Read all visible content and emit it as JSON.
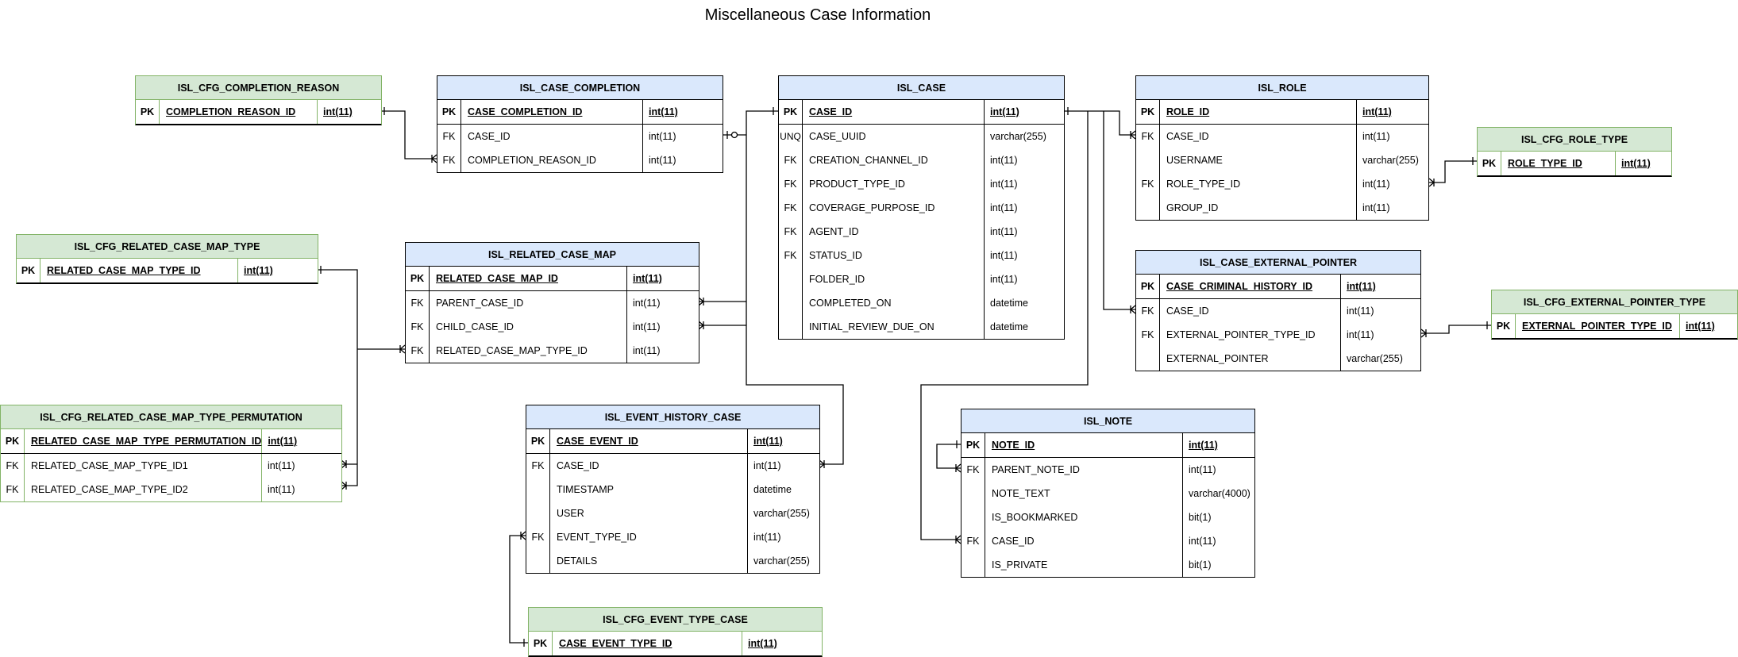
{
  "title": "Miscellaneous Case Information",
  "colors": {
    "entity_header": "#dae8fc",
    "config_header": "#d5e8d4",
    "config_border": "#82b366",
    "line": "#000000"
  },
  "tables": {
    "cfg_completion_reason": {
      "name": "ISL_CFG_COMPLETION_REASON",
      "rows": [
        {
          "key": "PK",
          "column": "COMPLETION_REASON_ID",
          "type": "int(11)"
        }
      ]
    },
    "case_completion": {
      "name": "ISL_CASE_COMPLETION",
      "rows": [
        {
          "key": "PK",
          "column": "CASE_COMPLETION_ID",
          "type": "int(11)"
        },
        {
          "key": "FK",
          "column": "CASE_ID",
          "type": "int(11)"
        },
        {
          "key": "FK",
          "column": "COMPLETION_REASON_ID",
          "type": "int(11)"
        }
      ]
    },
    "case": {
      "name": "ISL_CASE",
      "rows": [
        {
          "key": "PK",
          "column": "CASE_ID",
          "type": "int(11)"
        },
        {
          "key": "UNQ",
          "column": "CASE_UUID",
          "type": "varchar(255)"
        },
        {
          "key": "FK",
          "column": "CREATION_CHANNEL_ID",
          "type": "int(11)"
        },
        {
          "key": "FK",
          "column": "PRODUCT_TYPE_ID",
          "type": "int(11)"
        },
        {
          "key": "FK",
          "column": "COVERAGE_PURPOSE_ID",
          "type": "int(11)"
        },
        {
          "key": "FK",
          "column": "AGENT_ID",
          "type": "int(11)"
        },
        {
          "key": "FK",
          "column": "STATUS_ID",
          "type": "int(11)"
        },
        {
          "key": "",
          "column": "FOLDER_ID",
          "type": "int(11)"
        },
        {
          "key": "",
          "column": "COMPLETED_ON",
          "type": "datetime"
        },
        {
          "key": "",
          "column": "INITIAL_REVIEW_DUE_ON",
          "type": "datetime"
        }
      ]
    },
    "role": {
      "name": "ISL_ROLE",
      "rows": [
        {
          "key": "PK",
          "column": "ROLE_ID",
          "type": "int(11)"
        },
        {
          "key": "FK",
          "column": "CASE_ID",
          "type": "int(11)"
        },
        {
          "key": "",
          "column": "USERNAME",
          "type": "varchar(255)"
        },
        {
          "key": "FK",
          "column": "ROLE_TYPE_ID",
          "type": "int(11)"
        },
        {
          "key": "",
          "column": "GROUP_ID",
          "type": "int(11)"
        }
      ]
    },
    "cfg_role_type": {
      "name": "ISL_CFG_ROLE_TYPE",
      "rows": [
        {
          "key": "PK",
          "column": "ROLE_TYPE_ID",
          "type": "int(11)"
        }
      ]
    },
    "case_external_pointer": {
      "name": "ISL_CASE_EXTERNAL_POINTER",
      "rows": [
        {
          "key": "PK",
          "column": "CASE_CRIMINAL_HISTORY_ID",
          "type": "int(11)"
        },
        {
          "key": "FK",
          "column": "CASE_ID",
          "type": "int(11)"
        },
        {
          "key": "FK",
          "column": "EXTERNAL_POINTER_TYPE_ID",
          "type": "int(11)"
        },
        {
          "key": "",
          "column": "EXTERNAL_POINTER",
          "type": "varchar(255)"
        }
      ]
    },
    "cfg_external_pointer_type": {
      "name": "ISL_CFG_EXTERNAL_POINTER_TYPE",
      "rows": [
        {
          "key": "PK",
          "column": "EXTERNAL_POINTER_TYPE_ID",
          "type": "int(11)"
        }
      ]
    },
    "cfg_related_case_map_type": {
      "name": "ISL_CFG_RELATED_CASE_MAP_TYPE",
      "rows": [
        {
          "key": "PK",
          "column": "RELATED_CASE_MAP_TYPE_ID",
          "type": "int(11)"
        }
      ]
    },
    "related_case_map": {
      "name": "ISL_RELATED_CASE_MAP",
      "rows": [
        {
          "key": "PK",
          "column": "RELATED_CASE_MAP_ID",
          "type": "int(11)"
        },
        {
          "key": "FK",
          "column": "PARENT_CASE_ID",
          "type": "int(11)"
        },
        {
          "key": "FK",
          "column": "CHILD_CASE_ID",
          "type": "int(11)"
        },
        {
          "key": "FK",
          "column": "RELATED_CASE_MAP_TYPE_ID",
          "type": "int(11)"
        }
      ]
    },
    "cfg_related_case_map_type_permutation": {
      "name": "ISL_CFG_RELATED_CASE_MAP_TYPE_PERMUTATION",
      "rows": [
        {
          "key": "PK",
          "column": "RELATED_CASE_MAP_TYPE_PERMUTATION_ID",
          "type": "int(11)"
        },
        {
          "key": "FK",
          "column": "RELATED_CASE_MAP_TYPE_ID1",
          "type": "int(11)"
        },
        {
          "key": "FK",
          "column": "RELATED_CASE_MAP_TYPE_ID2",
          "type": "int(11)"
        }
      ]
    },
    "event_history_case": {
      "name": "ISL_EVENT_HISTORY_CASE",
      "rows": [
        {
          "key": "PK",
          "column": "CASE_EVENT_ID",
          "type": "int(11)"
        },
        {
          "key": "FK",
          "column": "CASE_ID",
          "type": "int(11)"
        },
        {
          "key": "",
          "column": "TIMESTAMP",
          "type": "datetime"
        },
        {
          "key": "",
          "column": "USER",
          "type": "varchar(255)"
        },
        {
          "key": "FK",
          "column": "EVENT_TYPE_ID",
          "type": "int(11)"
        },
        {
          "key": "",
          "column": "DETAILS",
          "type": "varchar(255)"
        }
      ]
    },
    "cfg_event_type_case": {
      "name": "ISL_CFG_EVENT_TYPE_CASE",
      "rows": [
        {
          "key": "PK",
          "column": "CASE_EVENT_TYPE_ID",
          "type": "int(11)"
        }
      ]
    },
    "note": {
      "name": "ISL_NOTE",
      "rows": [
        {
          "key": "PK",
          "column": "NOTE_ID",
          "type": "int(11)"
        },
        {
          "key": "FK",
          "column": "PARENT_NOTE_ID",
          "type": "int(11)"
        },
        {
          "key": "",
          "column": "NOTE_TEXT",
          "type": "varchar(4000)"
        },
        {
          "key": "",
          "column": "IS_BOOKMARKED",
          "type": "bit(1)"
        },
        {
          "key": "FK",
          "column": "CASE_ID",
          "type": "int(11)"
        },
        {
          "key": "",
          "column": "IS_PRIVATE",
          "type": "bit(1)"
        }
      ]
    }
  },
  "relationships": [
    {
      "from": "ISL_CFG_COMPLETION_REASON.COMPLETION_REASON_ID",
      "to": "ISL_CASE_COMPLETION.COMPLETION_REASON_ID",
      "cardinality": "one-to-many"
    },
    {
      "from": "ISL_CASE.CASE_ID",
      "to": "ISL_CASE_COMPLETION.CASE_ID",
      "cardinality": "one-to-zero-or-one"
    },
    {
      "from": "ISL_CASE.CASE_ID",
      "to": "ISL_RELATED_CASE_MAP.PARENT_CASE_ID",
      "cardinality": "one-to-many"
    },
    {
      "from": "ISL_CASE.CASE_ID",
      "to": "ISL_RELATED_CASE_MAP.CHILD_CASE_ID",
      "cardinality": "one-to-many"
    },
    {
      "from": "ISL_CASE.CASE_ID",
      "to": "ISL_EVENT_HISTORY_CASE.CASE_ID",
      "cardinality": "one-to-many"
    },
    {
      "from": "ISL_CASE.CASE_ID",
      "to": "ISL_ROLE.CASE_ID",
      "cardinality": "one-to-many"
    },
    {
      "from": "ISL_CASE.CASE_ID",
      "to": "ISL_CASE_EXTERNAL_POINTER.CASE_ID",
      "cardinality": "one-to-many"
    },
    {
      "from": "ISL_CASE.CASE_ID",
      "to": "ISL_NOTE.CASE_ID",
      "cardinality": "one-to-many"
    },
    {
      "from": "ISL_CFG_ROLE_TYPE.ROLE_TYPE_ID",
      "to": "ISL_ROLE.ROLE_TYPE_ID",
      "cardinality": "one-to-many"
    },
    {
      "from": "ISL_CFG_EXTERNAL_POINTER_TYPE.EXTERNAL_POINTER_TYPE_ID",
      "to": "ISL_CASE_EXTERNAL_POINTER.EXTERNAL_POINTER_TYPE_ID",
      "cardinality": "one-to-many"
    },
    {
      "from": "ISL_CFG_RELATED_CASE_MAP_TYPE.RELATED_CASE_MAP_TYPE_ID",
      "to": "ISL_RELATED_CASE_MAP.RELATED_CASE_MAP_TYPE_ID",
      "cardinality": "one-to-many"
    },
    {
      "from": "ISL_CFG_RELATED_CASE_MAP_TYPE.RELATED_CASE_MAP_TYPE_ID",
      "to": "ISL_CFG_RELATED_CASE_MAP_TYPE_PERMUTATION.RELATED_CASE_MAP_TYPE_ID1",
      "cardinality": "one-to-many"
    },
    {
      "from": "ISL_CFG_RELATED_CASE_MAP_TYPE.RELATED_CASE_MAP_TYPE_ID",
      "to": "ISL_CFG_RELATED_CASE_MAP_TYPE_PERMUTATION.RELATED_CASE_MAP_TYPE_ID2",
      "cardinality": "one-to-many"
    },
    {
      "from": "ISL_CFG_EVENT_TYPE_CASE.CASE_EVENT_TYPE_ID",
      "to": "ISL_EVENT_HISTORY_CASE.EVENT_TYPE_ID",
      "cardinality": "one-to-many"
    },
    {
      "from": "ISL_NOTE.NOTE_ID",
      "to": "ISL_NOTE.PARENT_NOTE_ID",
      "cardinality": "one-to-many"
    }
  ]
}
